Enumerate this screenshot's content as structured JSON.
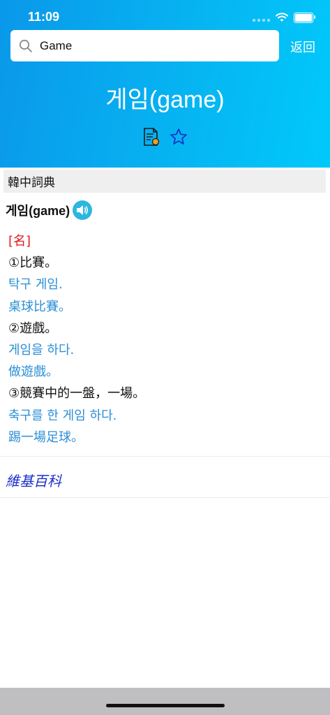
{
  "status_bar": {
    "time": "11:09"
  },
  "search": {
    "value": "Game",
    "back_label": "返回"
  },
  "header": {
    "headword": "게임(game)"
  },
  "section": {
    "title": "韓中詞典"
  },
  "entry": {
    "word": "게임(game)",
    "lines": [
      {
        "kind": "pos",
        "text": "[名]"
      },
      {
        "kind": "meaning",
        "text": "①比賽。"
      },
      {
        "kind": "example",
        "text": "탁구 게임."
      },
      {
        "kind": "example",
        "text": "桌球比賽。"
      },
      {
        "kind": "meaning",
        "text": "②遊戲。"
      },
      {
        "kind": "example",
        "text": "게임을 하다."
      },
      {
        "kind": "example",
        "text": "做遊戲。"
      },
      {
        "kind": "meaning",
        "text": "③競賽中的一盤，一場。"
      },
      {
        "kind": "example",
        "text": "축구를 한 게임 하다."
      },
      {
        "kind": "example",
        "text": "踢一場足球。"
      }
    ]
  },
  "wiki": {
    "label": "維基百科"
  },
  "colors": {
    "header_gradient_start": "#0a98ea",
    "header_gradient_end": "#00c9fb",
    "pos": "#e11a1a",
    "example": "#2b8fd6",
    "link": "#1b2fc9"
  }
}
